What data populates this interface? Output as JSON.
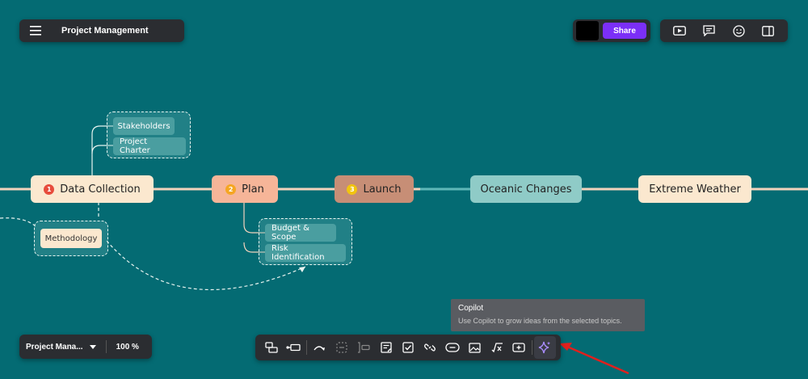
{
  "header": {
    "menu_icon": "hamburger-icon",
    "title": "Project Management"
  },
  "share": {
    "label": "Share",
    "swatch_color": "#000000"
  },
  "top_tools": [
    "play-icon",
    "comment-icon",
    "emoji-icon",
    "side-panel-icon"
  ],
  "footer": {
    "doc_name": "Project Mana...",
    "zoom": "100 %"
  },
  "mindmap": {
    "main_topics": [
      {
        "label": "Data Collection",
        "number": "1",
        "badge_color": "#e74c3c"
      },
      {
        "label": "Plan",
        "number": "2",
        "badge_color": "#f5a623"
      },
      {
        "label": "Launch",
        "number": "3",
        "badge_color": "#f1c40f"
      },
      {
        "label": "Oceanic Changes"
      },
      {
        "label": "Extreme Weather"
      }
    ],
    "subtopics": {
      "data_collection": [
        "Stakeholders",
        "Project Charter"
      ],
      "plan": [
        "Budget & Scope",
        "Risk Identification"
      ]
    },
    "floating": "Methodology"
  },
  "tooltip": {
    "title": "Copilot",
    "text": "Use Copilot to grow ideas from the selected topics."
  },
  "toolbar_tools": [
    "subtopic-icon",
    "topic-icon",
    "relationship-icon",
    "boundary-icon",
    "summary-icon",
    "note-icon",
    "task-icon",
    "link-icon",
    "label-icon",
    "image-icon",
    "equation-icon",
    "add-icon",
    "copilot-icon"
  ]
}
